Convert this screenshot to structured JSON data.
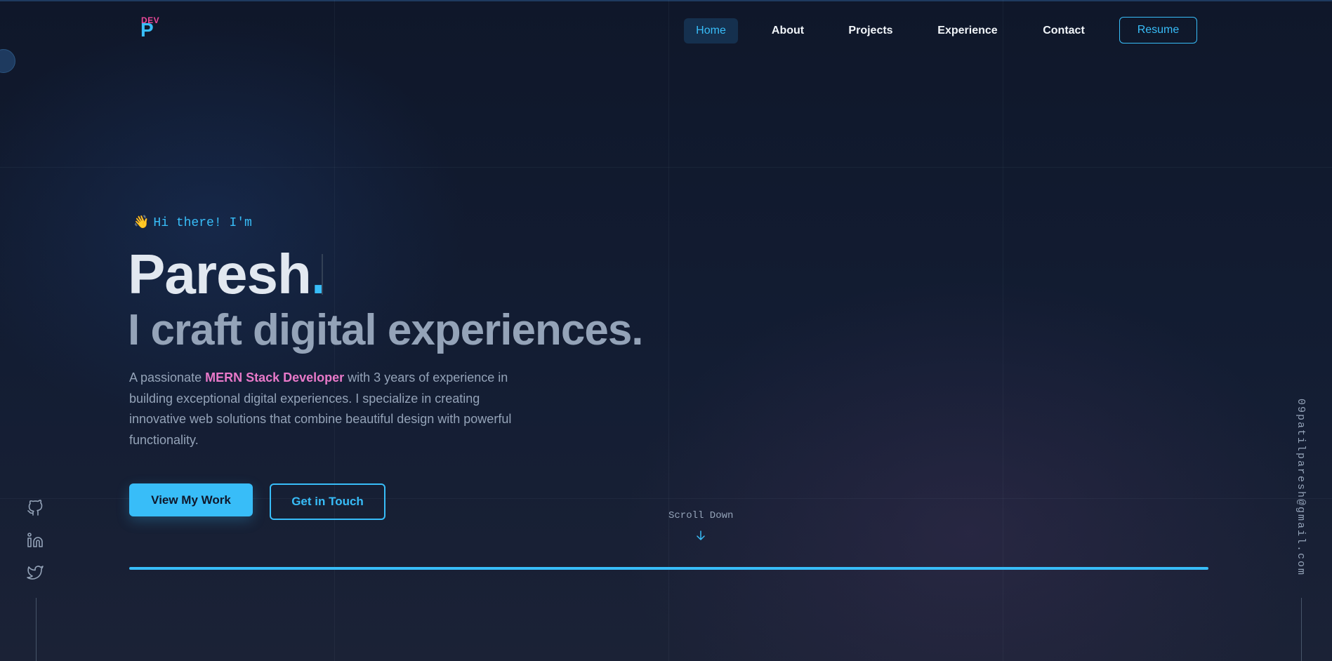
{
  "logo": {
    "top": "DEV",
    "letter": "P"
  },
  "nav": {
    "items": [
      "Home",
      "About",
      "Projects",
      "Experience",
      "Contact"
    ],
    "active": "Home",
    "resume_label": "Resume"
  },
  "hero": {
    "greeting_emoji": "👋",
    "greeting": "Hi there! I'm",
    "name": "Paresh",
    "name_dot": ".",
    "tagline": "I craft digital experiences.",
    "desc_before": "A passionate ",
    "desc_highlight": "MERN Stack Developer",
    "desc_after": " with 3 years of experience in building exceptional digital experiences. I specialize in creating innovative web solutions that combine beautiful design with powerful functionality.",
    "primary_button": "View My Work",
    "secondary_button": "Get in Touch",
    "scroll_label": "Scroll Down"
  },
  "social": {
    "icons": [
      "github-icon",
      "linkedin-icon",
      "twitter-icon"
    ]
  },
  "email": "09patilparesh@gmail.com",
  "colors": {
    "background": "#0f172a",
    "accent": "#38bdf8",
    "highlight": "#e879c9",
    "muted": "#94a3b8"
  }
}
